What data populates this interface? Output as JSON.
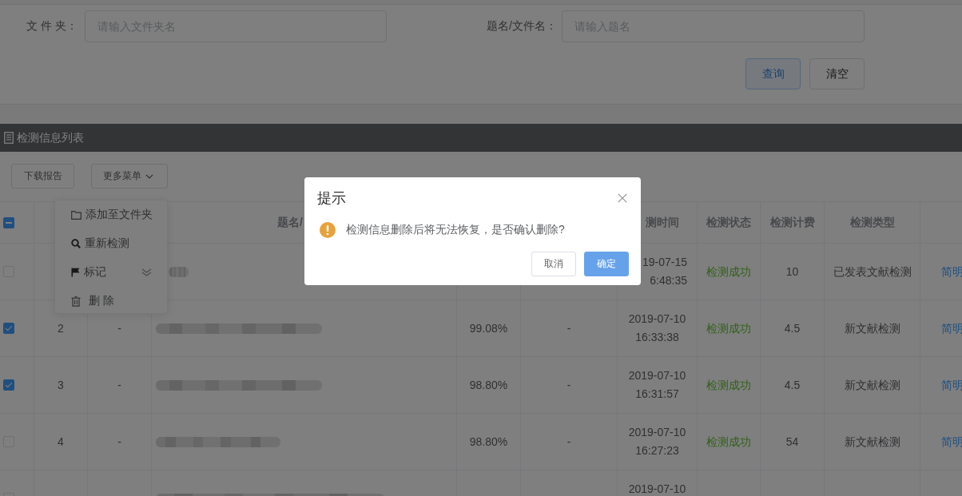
{
  "filters": [
    {
      "label": "文 件 夹：",
      "placeholder": "请输入文件夹名"
    },
    {
      "label": "题名/文件名：",
      "placeholder": "请输入题名"
    }
  ],
  "filter_buttons": [
    {
      "label": "查询",
      "kind": "primary"
    },
    {
      "label": "清空",
      "kind": "default"
    }
  ],
  "panel": {
    "title": "检测信息列表"
  },
  "toolbar": [
    {
      "label": "下载报告",
      "dropdown": false
    },
    {
      "label": "更多菜单",
      "dropdown": true
    }
  ],
  "menu": {
    "items": [
      {
        "label": "添加至文件夹",
        "submenu": false
      },
      {
        "label": "重新检测",
        "submenu": false
      },
      {
        "label": "标记",
        "submenu": true
      },
      {
        "label": "删 除",
        "submenu": false
      }
    ]
  },
  "table": {
    "select_all": {
      "indeterminate": true
    },
    "header": {
      "column_4": "题名/",
      "column_7": "测时间",
      "column_8": "检测状态",
      "column_9": "检测计费",
      "column_10": "检测类型"
    },
    "rows": [
      {
        "checked": false,
        "column_7": "19-07-15 6:48:35",
        "column_8": "检测成功",
        "column_9": "10",
        "column_10": "已发表文献检测",
        "column_11": "简明"
      },
      {
        "checked": true,
        "column_2": "2",
        "column_3": "-",
        "column_5": "99.08%",
        "column_6": "-",
        "column_7": "2019-07-10 16:33:38",
        "column_8": "检测成功",
        "column_9": "4.5",
        "column_10": "新文献检测",
        "column_11": "简明"
      },
      {
        "checked": true,
        "column_2": "3",
        "column_3": "-",
        "column_5": "98.80%",
        "column_6": "-",
        "column_7": "2019-07-10 16:31:57",
        "column_8": "检测成功",
        "column_9": "4.5",
        "column_10": "新文献检测",
        "column_11": "简明"
      },
      {
        "checked": false,
        "column_2": "4",
        "column_3": "-",
        "column_5": "98.80%",
        "column_6": "-",
        "column_7": "2019-07-10 16:27:23",
        "column_8": "检测成功",
        "column_9": "54",
        "column_10": "新文献检测",
        "column_11": "简明"
      },
      {
        "checked": false,
        "column_7": "2019-07-10"
      }
    ]
  },
  "dialog": {
    "title": "提示",
    "message": "检测信息删除后将无法恢复，是否确认删除?",
    "buttons": [
      {
        "label": "取消",
        "kind": "default"
      },
      {
        "label": "确定",
        "kind": "primary"
      }
    ]
  }
}
